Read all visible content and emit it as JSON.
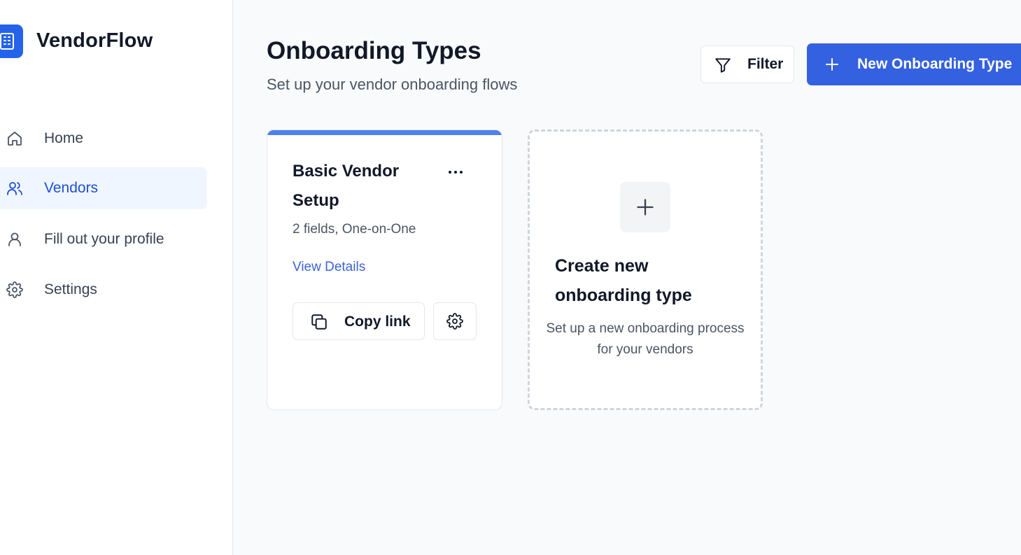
{
  "app": {
    "name": "VendorFlow",
    "logo_icon": "building-icon",
    "accent": "#2563eb"
  },
  "sidebar": {
    "items": [
      {
        "label": "Home",
        "icon": "home-icon",
        "active": false
      },
      {
        "label": "Vendors",
        "icon": "users-icon",
        "active": true
      },
      {
        "label": "Fill out your profile",
        "icon": "user-icon",
        "active": false
      },
      {
        "label": "Settings",
        "icon": "gear-icon",
        "active": false
      }
    ]
  },
  "header": {
    "title": "Onboarding Types",
    "subtitle": "Set up your vendor onboarding flows",
    "filter_label": "Filter",
    "new_label": "New Onboarding Type"
  },
  "cards": [
    {
      "title": "Basic Vendor Setup",
      "meta": "2 fields, One-on-One",
      "link_label": "View Details",
      "copy_label": "Copy link",
      "accent": "#4f80ec"
    }
  ],
  "create_card": {
    "title": "Create new onboarding type",
    "description": "Set up a new onboarding process for your vendors"
  }
}
